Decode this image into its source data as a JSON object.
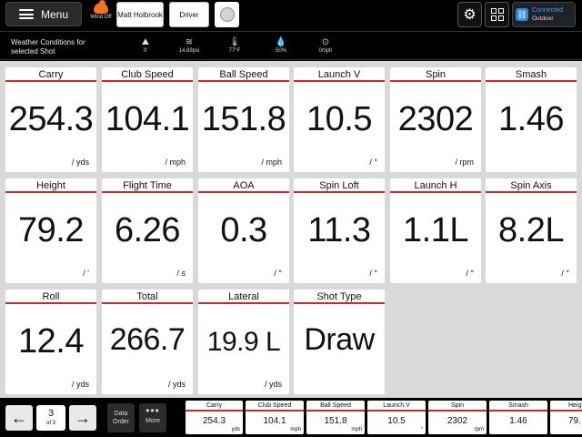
{
  "header": {
    "menu_label": "Menu",
    "wind_label": "Wind Off",
    "player": "Matt Holbrook",
    "club": "Driver",
    "connection_status": "Connected",
    "connection_mode": "Outdoor"
  },
  "weather": {
    "label": "Weather Conditions for selected Shot",
    "altitude": "0'",
    "pressure": "14.69psi",
    "temperature": "77°F",
    "humidity": "50%",
    "wind": "0mph"
  },
  "tiles": [
    {
      "name": "Carry",
      "value": "254.3",
      "unit": "/ yds"
    },
    {
      "name": "Club Speed",
      "value": "104.1",
      "unit": "/ mph"
    },
    {
      "name": "Ball Speed",
      "value": "151.8",
      "unit": "/ mph"
    },
    {
      "name": "Launch V",
      "value": "10.5",
      "unit": "/ °"
    },
    {
      "name": "Spin",
      "value": "2302",
      "unit": "/ rpm"
    },
    {
      "name": "Smash",
      "value": "1.46",
      "unit": ""
    },
    {
      "name": "Height",
      "value": "79.2",
      "unit": "/ '"
    },
    {
      "name": "Flight Time",
      "value": "6.26",
      "unit": "/ s"
    },
    {
      "name": "AOA",
      "value": "0.3",
      "unit": "/ °"
    },
    {
      "name": "Spin Loft",
      "value": "11.3",
      "unit": "/ °"
    },
    {
      "name": "Launch H",
      "value": "1.1L",
      "unit": "/ °"
    },
    {
      "name": "Spin Axis",
      "value": "8.2L",
      "unit": "/ °"
    },
    {
      "name": "Roll",
      "value": "12.4",
      "unit": "/ yds"
    },
    {
      "name": "Total",
      "value": "266.7",
      "unit": "/ yds"
    },
    {
      "name": "Lateral",
      "value": "19.9 L",
      "unit": "/ yds"
    },
    {
      "name": "Shot Type",
      "value": "Draw",
      "unit": ""
    }
  ],
  "pager": {
    "page": "3",
    "of": "of 3",
    "data_order_label": "Data Order",
    "more_label": "More"
  },
  "strip": [
    {
      "name": "Carry",
      "value": "254.3",
      "unit": "yds"
    },
    {
      "name": "Club Speed",
      "value": "104.1",
      "unit": "mph"
    },
    {
      "name": "Ball Speed",
      "value": "151.8",
      "unit": "mph"
    },
    {
      "name": "Launch V",
      "value": "10.5",
      "unit": "°"
    },
    {
      "name": "Spin",
      "value": "2302",
      "unit": "rpm"
    },
    {
      "name": "Smash",
      "value": "1.46",
      "unit": ""
    },
    {
      "name": "Height",
      "value": "79.",
      "unit": ""
    }
  ]
}
